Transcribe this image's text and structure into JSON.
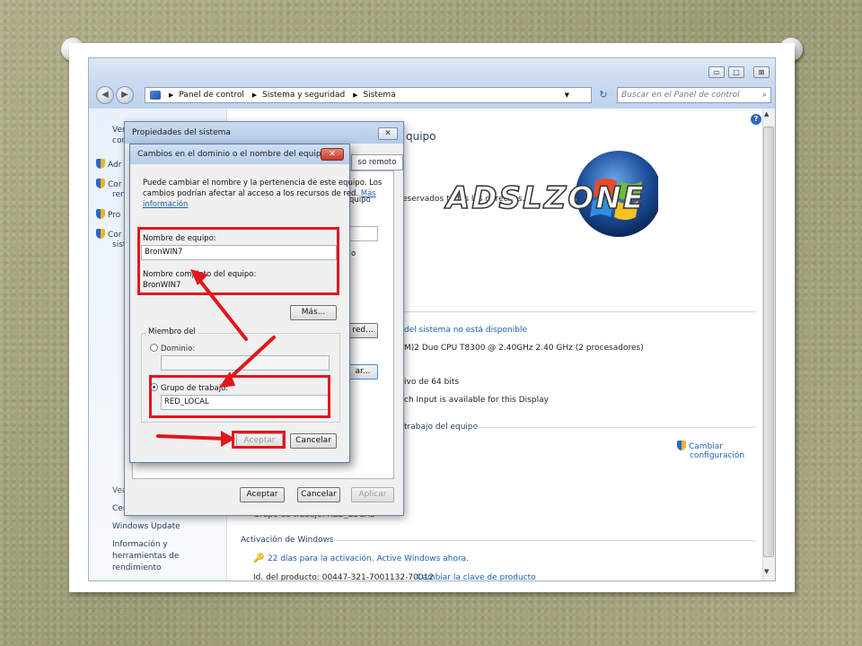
{
  "window": {
    "minimize_glyph": "▭",
    "maximize_glyph": "□",
    "close_glyph": "⊠"
  },
  "address_bar": {
    "back_glyph": "◀",
    "forward_glyph": "▶",
    "crumbs": [
      "Panel de control",
      "Sistema y seguridad",
      "Sistema"
    ],
    "refresh_glyph": "↻",
    "search_placeholder": "Buscar en el Panel de control"
  },
  "left_pane": {
    "items": [
      {
        "label": "Ver"
      },
      {
        "label": "con"
      },
      {
        "label": "Adr"
      },
      {
        "label": "Cor"
      },
      {
        "label": "ren"
      },
      {
        "label": "Pro"
      },
      {
        "label": "Cor"
      },
      {
        "label": "sist"
      }
    ],
    "see_also_label": "Vea",
    "see_also_items": [
      {
        "label": "Cer"
      },
      {
        "label": "Windows Update"
      },
      {
        "label": "Información y herramientas de rendimiento"
      }
    ]
  },
  "main": {
    "heading_fragment": "quipo",
    "copyright_fragment": "eservados todos los derechos.",
    "rating_link": "del sistema no está disponible",
    "processor_fragment": "M)2 Duo CPU    T8300  @ 2.40GHz   2.40 GHz  (2 procesadores)",
    "os_type_fragment": "ivo de 64 bits",
    "pen_fragment": "ch Input is available for this Display",
    "section_workgroup": "trabajo del equipo",
    "change_settings_line1": "Cambiar",
    "change_settings_line2": "configuración",
    "cropped_row": "Grupo de trabajo:            RED_LOCAL",
    "activation_section": "Activación de Windows",
    "activation_link": "22 días para la activación. Active Windows ahora.",
    "product_id": "Id. del producto: 00447-321-7001132-70012",
    "product_key_link": "Cambiar la clave de producto",
    "help_glyph": "?"
  },
  "logo": {
    "text": "ADSLZONE"
  },
  "props_dialog": {
    "title": "Propiedades del sistema",
    "close_glyph": "✕",
    "tab_remote": "so remoto",
    "fragment_equipo": "quipo",
    "fragment_o": "o",
    "btn_red": "red...",
    "btn_ar": "ar...",
    "ok": "Aceptar",
    "cancel": "Cancelar",
    "apply": "Aplicar"
  },
  "change_dialog": {
    "title": "Cambios en el dominio o el nombre del equipo",
    "close_glyph": "✕",
    "description_line1": "Puede cambiar el nombre y la pertenencia de este equipo. Los",
    "description_line2": "cambios podrían afectar al acceso a los recursos de red.",
    "description_link1": "Más",
    "description_link2": "información",
    "computer_name_label": "Nombre de equipo:",
    "computer_name_value": "BronWIN7",
    "full_name_label": "Nombre completo del equipo:",
    "full_name_value": "BronWIN7",
    "more_button": "Más...",
    "member_of_label": "Miembro del",
    "domain_label": "Dominio:",
    "domain_value": "",
    "workgroup_label": "Grupo de trabajo:",
    "workgroup_value": "RED_LOCAL",
    "ok": "Aceptar",
    "cancel": "Cancelar"
  },
  "colors": {
    "highlight_red": "#e3161c",
    "link_blue": "#1b5fb3",
    "titlebar_blue": "#c9daf0"
  }
}
